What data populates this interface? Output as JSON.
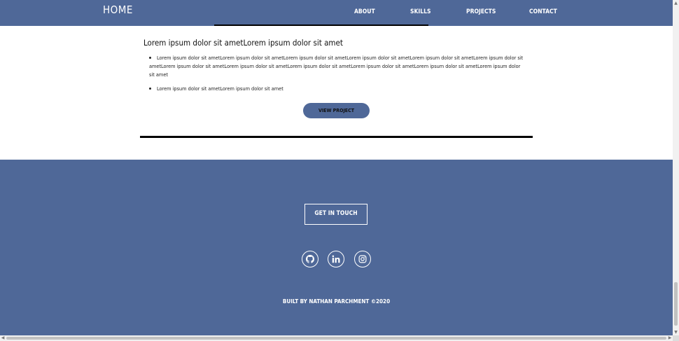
{
  "navbar": {
    "brand": "HOME",
    "items": [
      "ABOUT",
      "SKILLS",
      "PROJECTS",
      "CONTACT"
    ]
  },
  "project": {
    "title": "Lorem ipsum dolor sit ametLorem ipsum dolor sit amet",
    "bullets": [
      "Lorem ipsum dolor sit ametLorem ipsum dolor sit ametLorem ipsum dolor sit ametLorem ipsum dolor sit ametLorem ipsum dolor sit ametLorem ipsum dolor sit ametLorem ipsum dolor sit ametLorem ipsum dolor sit ametLorem ipsum dolor sit ametLorem ipsum dolor sit ametLorem ipsum dolor sit ametLorem ipsum dolor sit amet",
      "Lorem ipsum dolor sit ametLorem ipsum dolor sit amet"
    ],
    "button_label": "VIEW PROJECT"
  },
  "footer": {
    "cta_label": "GET IN TOUCH",
    "social": [
      {
        "name": "github-icon"
      },
      {
        "name": "linkedin-icon"
      },
      {
        "name": "instagram-icon"
      }
    ],
    "credit": "BUILT BY NATHAN PARCHMENT ©2020"
  },
  "colors": {
    "brand": "#4f6898",
    "text": "#111111",
    "background": "#ffffff"
  }
}
